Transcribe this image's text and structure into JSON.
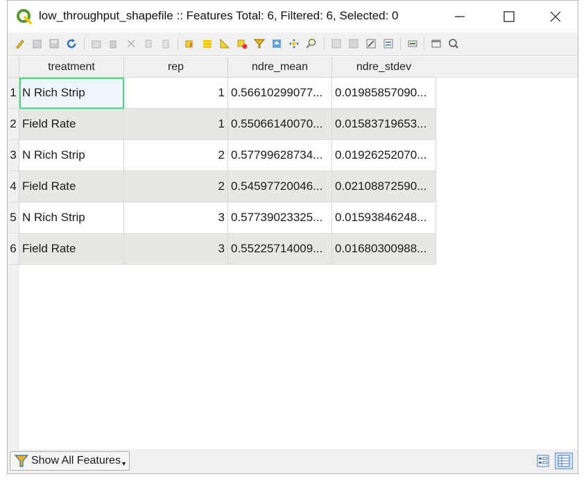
{
  "window": {
    "title": "low_throughput_shapefile :: Features Total: 6, Filtered: 6, Selected: 0",
    "icon": "qgis-logo-icon",
    "controls": [
      "minimize-icon",
      "maximize-icon",
      "close-icon"
    ]
  },
  "toolbar": {
    "icons": [
      "toggle-editing-icon",
      "toggle-multi-edit-icon",
      "save-edits-icon",
      "reload-table-icon",
      "add-feature-icon",
      "delete-selected-icon",
      "cut-icon",
      "copy-icon",
      "paste-icon",
      "select-by-expression-icon",
      "select-all-icon",
      "invert-selection-icon",
      "deselect-all-icon",
      "filter-select-icon",
      "move-selection-top-icon",
      "pan-to-selected-icon",
      "zoom-to-selected-icon",
      "new-field-icon",
      "delete-field-icon",
      "open-field-calculator-icon",
      "conditional-formatting-icon",
      "actions-icon",
      "dock-table-icon",
      "help-icon"
    ]
  },
  "table": {
    "columns": [
      "treatment",
      "rep",
      "ndre_mean",
      "ndre_stdev"
    ],
    "rows": [
      {
        "num": "1",
        "treatment": "N Rich Strip",
        "rep": "1",
        "ndre_mean": "0.56610299077...",
        "ndre_stdev": "0.01985857090..."
      },
      {
        "num": "2",
        "treatment": "Field Rate",
        "rep": "1",
        "ndre_mean": "0.55066140070...",
        "ndre_stdev": "0.01583719653..."
      },
      {
        "num": "3",
        "treatment": "N Rich Strip",
        "rep": "2",
        "ndre_mean": "0.57799628734...",
        "ndre_stdev": "0.01926252070..."
      },
      {
        "num": "4",
        "treatment": "Field Rate",
        "rep": "2",
        "ndre_mean": "0.54597720046...",
        "ndre_stdev": "0.02108872590..."
      },
      {
        "num": "5",
        "treatment": "N Rich Strip",
        "rep": "3",
        "ndre_mean": "0.57739023325...",
        "ndre_stdev": "0.01593846248..."
      },
      {
        "num": "6",
        "treatment": "Field Rate",
        "rep": "3",
        "ndre_mean": "0.55225714009...",
        "ndre_stdev": "0.01680300988..."
      }
    ]
  },
  "footer": {
    "show_all_label": "Show All Features",
    "show_all_icon": "filter-funnel-icon",
    "view_buttons": [
      "form-view-icon",
      "table-view-icon"
    ]
  },
  "colors": {
    "selection_outline": "#3ddc84",
    "alt_row": "#e9e7e3",
    "qgis_green": "#589632",
    "qgis_yellow": "#eec90d"
  }
}
